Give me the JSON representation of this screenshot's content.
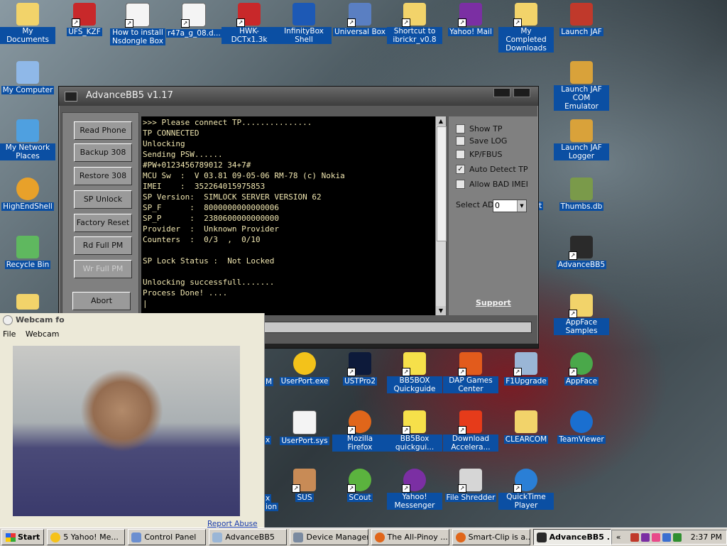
{
  "desktop_icons_row1": [
    {
      "label": "My Documents",
      "icon": "folder-documents-icon"
    },
    {
      "label": "UFS_KZF",
      "icon": "pc-shortcut-icon"
    },
    {
      "label": "How to install Nsdongle Box",
      "icon": "document-icon"
    },
    {
      "label": "r47a_g_08.d...",
      "icon": "document-icon"
    },
    {
      "label": "HWK-DCTx1.3k",
      "icon": "pc-shortcut-icon"
    },
    {
      "label": "InfinityBox Shell",
      "icon": "infinity-icon"
    },
    {
      "label": "Universal Box",
      "icon": "box-icon"
    },
    {
      "label": "Shortcut to ibrickr_v0.8",
      "icon": "folder-icon"
    },
    {
      "label": "Yahoo! Mail",
      "icon": "yahoo-mail-icon"
    },
    {
      "label": "My Completed Downloads",
      "icon": "folder-icon"
    },
    {
      "label": "Launch JAF",
      "icon": "jaf-icon"
    }
  ],
  "desktop_icons_col1": [
    {
      "label": "My Computer",
      "icon": "computer-icon"
    },
    {
      "label": "My Network Places",
      "icon": "network-icon"
    },
    {
      "label": "HighEndShell",
      "icon": "pooh-icon"
    },
    {
      "label": "Recycle Bin",
      "icon": "recycle-bin-icon"
    }
  ],
  "desktop_icons_right": [
    {
      "label": "Launch JAF COM Emulator",
      "icon": "jaf-icon"
    },
    {
      "label": "Launch JAF Logger",
      "icon": "jaf-icon"
    },
    {
      "label": "Thumbs.db",
      "icon": "file-icon"
    },
    {
      "label": "AdvanceBB5",
      "icon": "advancebb5-icon"
    },
    {
      "label": "AppFace Samples",
      "icon": "folder-icon"
    },
    {
      "label": "AppFace",
      "icon": "appface-icon"
    },
    {
      "label": "TeamViewer",
      "icon": "teamviewer-icon"
    }
  ],
  "desktop_icons_bottom": [
    {
      "label": "UserPort.exe",
      "icon": "hazard-icon"
    },
    {
      "label": "USTPro2",
      "icon": "ustpro-icon"
    },
    {
      "label": "BB5BOX Quickguide",
      "icon": "spongebob-icon"
    },
    {
      "label": "DAP Games Center",
      "icon": "games-icon"
    },
    {
      "label": "F1Upgrade",
      "icon": "upgrade-icon"
    },
    {
      "label": "UserPort.sys",
      "icon": "document-icon"
    },
    {
      "label": "Mozilla Firefox",
      "icon": "firefox-icon"
    },
    {
      "label": "BB5Box quickgui...",
      "icon": "spongebob-icon"
    },
    {
      "label": "Download Accelera...",
      "icon": "download-accelerator-icon"
    },
    {
      "label": "CLEARCOM",
      "icon": "folder-icon"
    },
    {
      "label": "SUS",
      "icon": "person-icon"
    },
    {
      "label": "SCout",
      "icon": "scout-icon"
    },
    {
      "label": "Yahoo! Messenger",
      "icon": "yahoo-messenger-icon"
    },
    {
      "label": "File Shredder",
      "icon": "shredder-icon"
    },
    {
      "label": "QuickTime Player",
      "icon": "quicktime-icon"
    }
  ],
  "partial_labels": {
    "m": "M",
    "x1": "x",
    "x2": "x",
    "ion": "ion",
    "t": "t"
  },
  "advancebb5": {
    "title": "AdvanceBB5 v1.17",
    "buttons": {
      "read_phone": "Read Phone",
      "backup": "Backup 308",
      "restore": "Restore 308",
      "sp_unlock": "SP Unlock",
      "factory_reset": "Factory Reset",
      "rd_full_pm": "Rd Full PM",
      "wr_full_pm": "Wr Full PM",
      "abort": "Abort"
    },
    "console_lines": [
      ">>> Please connect TP...............",
      "TP CONNECTED",
      "Unlocking",
      "Sending PSW......",
      "#PW+0123456789012 34+7#",
      "MCU Sw  :  V 03.81 09-05-06 RM-78 (c) Nokia",
      "IMEI    :  352264015975853",
      "SP Version:  SIMLOCK SERVER VERSION 62",
      "SP_F      :  8000000000000006",
      "SP_P      :  2380600000000000",
      "Provider  :  Unknown Provider",
      "Counters  :  0/3  ,  0/10",
      "",
      "SP Lock Status :  Not Locked",
      "",
      "Unlocking successfull.......",
      "Process Done! ....",
      "|"
    ],
    "options": {
      "show_tp": {
        "label": "Show TP",
        "checked": false
      },
      "save_log": {
        "label": "Save LOG",
        "checked": false
      },
      "kp_fbus": {
        "label": "KP/FBUS",
        "checked": false
      },
      "auto_detect_tp": {
        "label": "Auto Detect TP",
        "checked": true
      },
      "allow_bad_imei": {
        "label": "Allow BAD IMEI",
        "checked": false
      }
    },
    "select_ad": {
      "label": "Select AD",
      "value": "0"
    },
    "support_link": "Support"
  },
  "webcam": {
    "title": "Webcam fo",
    "menu": [
      "File",
      "Webcam"
    ],
    "report_link": "Report Abuse"
  },
  "taskbar": {
    "start": "Start",
    "tasks": [
      {
        "label": "5 Yahoo! Me...",
        "active": false
      },
      {
        "label": "Control Panel",
        "active": false
      },
      {
        "label": "AdvanceBB5",
        "active": false
      },
      {
        "label": "Device Manager",
        "active": false
      },
      {
        "label": "The All-Pinoy ...",
        "active": false
      },
      {
        "label": "Smart-Clip is a...",
        "active": false
      },
      {
        "label": "AdvanceBB5 ...",
        "active": true
      }
    ],
    "clock": "2:37 PM"
  },
  "colors": {
    "icon_label_bg": "#0b4fa3",
    "window_bg": "#5a5a5a",
    "console_text": "#f0e6b0",
    "taskbar": "#d4d0c8"
  }
}
